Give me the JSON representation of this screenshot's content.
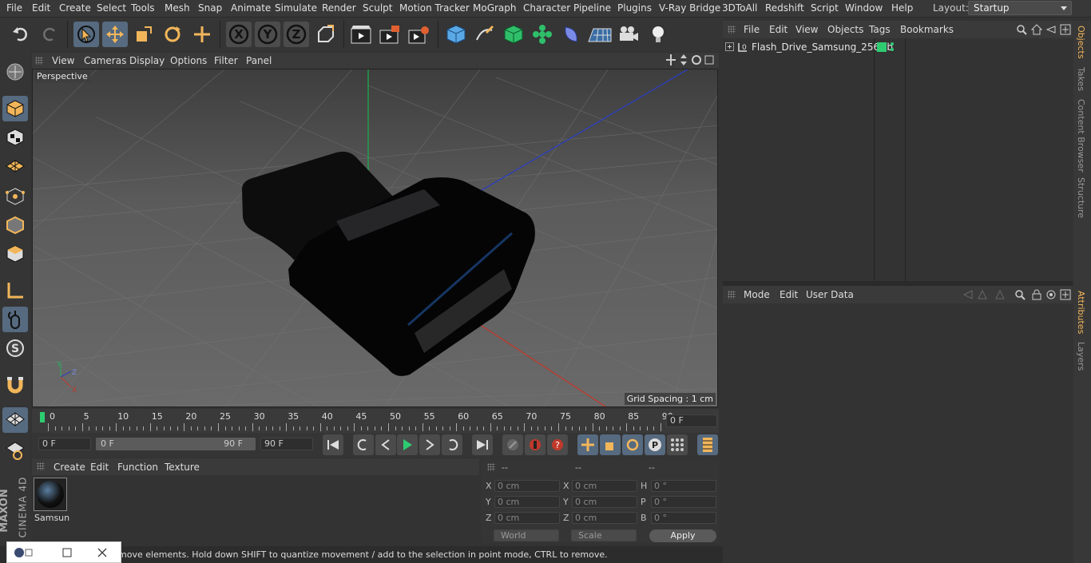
{
  "menubar": {
    "items": [
      "File",
      "Edit",
      "Create",
      "Select",
      "Tools",
      "Mesh",
      "Snap",
      "Animate",
      "Simulate",
      "Render",
      "Sculpt",
      "Motion Tracker",
      "MoGraph",
      "Character",
      "Pipeline",
      "Plugins",
      "V-Ray Bridge",
      "3DToAll",
      "Redshift",
      "Script",
      "Window",
      "Help"
    ],
    "layout_label": "Layout:",
    "layout_value": "Startup"
  },
  "toolbar": {
    "icons": [
      "undo-icon",
      "redo-icon",
      "live-selection-icon",
      "move-icon",
      "scale-icon",
      "rotate-icon",
      "recent-tool-icon",
      "x-axis-icon",
      "y-axis-icon",
      "z-axis-icon",
      "coordinate-system-icon",
      "render-view-icon",
      "render-picture-viewer-icon",
      "edit-render-settings-icon",
      "cube-primitive-icon",
      "spline-pen-icon",
      "subdivision-icon",
      "cloner-icon",
      "deformer-icon",
      "floor-icon",
      "camera-icon",
      "light-icon"
    ],
    "axis_labels": [
      "X",
      "Y",
      "Z"
    ]
  },
  "leftbar": {
    "icons": [
      "make-editable-icon",
      "model-mode-icon",
      "texture-mode-icon",
      "workplane-icon",
      "points-mode-icon",
      "edges-mode-icon",
      "polygons-mode-icon",
      "axis-mode-icon",
      "tweak-mode-icon",
      "solo-icon",
      "snap-icon",
      "quantize-icon",
      "locked-workplane-icon"
    ],
    "solo_label": "S"
  },
  "viewport": {
    "menu": [
      "View",
      "Cameras",
      "Display",
      "Options",
      "Filter",
      "Panel"
    ],
    "label": "Perspective",
    "grid_spacing": "Grid Spacing : 1 cm",
    "axis_x": "X",
    "axis_y": "Y",
    "axis_z": "Z"
  },
  "timeline": {
    "ticks": [
      "0",
      "5",
      "10",
      "15",
      "20",
      "25",
      "30",
      "35",
      "40",
      "45",
      "50",
      "55",
      "60",
      "65",
      "70",
      "75",
      "80",
      "85",
      "90"
    ],
    "current_frame": "0 F"
  },
  "transport": {
    "start_field": "0 F",
    "range_start": "0 F",
    "range_end": "90 F",
    "end_field": "90 F"
  },
  "materials": {
    "menu": [
      "Create",
      "Edit",
      "Function",
      "Texture"
    ],
    "items": [
      {
        "name": "Samsun"
      }
    ]
  },
  "coordinates": {
    "headers": [
      "--",
      "--",
      "--"
    ],
    "rows": [
      {
        "a": "X",
        "av": "0 cm",
        "b": "X",
        "bv": "0 cm",
        "c": "H",
        "cv": "0 °"
      },
      {
        "a": "Y",
        "av": "0 cm",
        "b": "Y",
        "bv": "0 cm",
        "c": "P",
        "cv": "0 °"
      },
      {
        "a": "Z",
        "av": "0 cm",
        "b": "Z",
        "bv": "0 cm",
        "c": "B",
        "cv": "0 °"
      }
    ],
    "space": "World",
    "mode": "Scale",
    "apply": "Apply"
  },
  "objects": {
    "menu": [
      "File",
      "Edit",
      "View",
      "Objects",
      "Tags",
      "Bookmarks"
    ],
    "items": [
      {
        "name": "Flash_Drive_Samsung_256Gb"
      }
    ]
  },
  "attributes": {
    "menu": [
      "Mode",
      "Edit",
      "User Data"
    ]
  },
  "right_tabs": [
    "Objects",
    "Takes",
    "Content Browser",
    "Structure",
    "Attributes",
    "Layers"
  ],
  "status": {
    "text": "move elements. Hold down SHIFT to quantize movement / add to the selection in point mode, CTRL to remove."
  },
  "brand": {
    "maxon": "MAXON",
    "product": "CINEMA 4D"
  },
  "colors": {
    "accent": "#566a80",
    "orange": "#f2b65a",
    "green_marker": "#2ecc71",
    "x_axis": "#c0392b",
    "y_axis": "#27ae60",
    "z_axis": "#2c3fbf"
  }
}
